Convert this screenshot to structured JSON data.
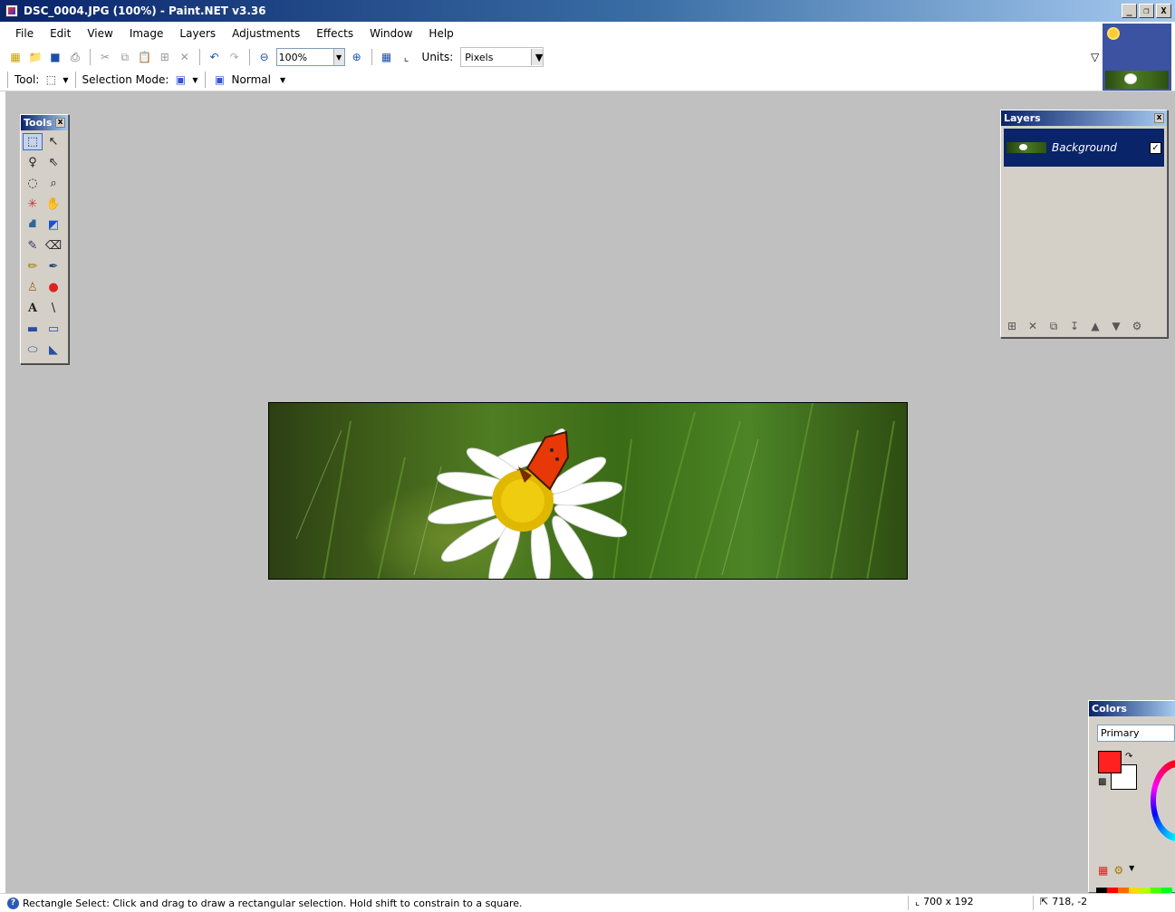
{
  "window": {
    "title": "DSC_0004.JPG (100%) - Paint.NET v3.36",
    "controls": {
      "minimize": "_",
      "restore": "❐",
      "close": "X"
    }
  },
  "menu": [
    "File",
    "Edit",
    "View",
    "Image",
    "Layers",
    "Adjustments",
    "Effects",
    "Window",
    "Help"
  ],
  "toolbar": {
    "zoom_value": "100%",
    "units_label": "Units:",
    "units_value": "Pixels"
  },
  "tool_options": {
    "tool_label": "Tool:",
    "selection_mode_label": "Selection Mode:",
    "blend_mode": "Normal"
  },
  "tools_panel": {
    "title": "Tools",
    "tools": [
      {
        "name": "rectangle-select",
        "glyph": "⬚"
      },
      {
        "name": "move-selected-pixels",
        "glyph": "↖"
      },
      {
        "name": "lasso-select",
        "glyph": "♀"
      },
      {
        "name": "move-selection",
        "glyph": "⇖"
      },
      {
        "name": "ellipse-select",
        "glyph": "◌"
      },
      {
        "name": "zoom",
        "glyph": "⌕"
      },
      {
        "name": "magic-wand",
        "glyph": "✳"
      },
      {
        "name": "pan",
        "glyph": "✋"
      },
      {
        "name": "paint-bucket",
        "glyph": "⛘"
      },
      {
        "name": "gradient",
        "glyph": "◩"
      },
      {
        "name": "paintbrush",
        "glyph": "✎"
      },
      {
        "name": "eraser",
        "glyph": "⌫"
      },
      {
        "name": "pencil",
        "glyph": "✏"
      },
      {
        "name": "color-picker",
        "glyph": "✒"
      },
      {
        "name": "clone-stamp",
        "glyph": "♙"
      },
      {
        "name": "recolor",
        "glyph": "●"
      },
      {
        "name": "text",
        "glyph": "A"
      },
      {
        "name": "line-curve",
        "glyph": "\\"
      },
      {
        "name": "rectangle",
        "glyph": "▬"
      },
      {
        "name": "rounded-rectangle",
        "glyph": "▭"
      },
      {
        "name": "ellipse",
        "glyph": "⬭"
      },
      {
        "name": "freeform-shape",
        "glyph": "◣"
      }
    ]
  },
  "layers_panel": {
    "title": "Layers",
    "layers": [
      {
        "name": "Background",
        "visible": true
      }
    ]
  },
  "colors_panel": {
    "title": "Colors",
    "mode": "Primary",
    "primary_color": "#ff2020",
    "secondary_color": "#ffffff",
    "palette": [
      "#000000",
      "#ff0000",
      "#ff6a00",
      "#ffd800",
      "#b6ff00",
      "#4cff00",
      "#00ff21",
      "#404040",
      "#7f0000",
      "#7f3300",
      "#7f6a00",
      "#5b7f00",
      "#267f00",
      "#007f0e"
    ]
  },
  "status": {
    "help_text": "Rectangle Select: Click and drag to draw a rectangular selection. Hold shift to constrain to a square.",
    "image_size": "700 x 192",
    "cursor_position": "718, -2"
  }
}
